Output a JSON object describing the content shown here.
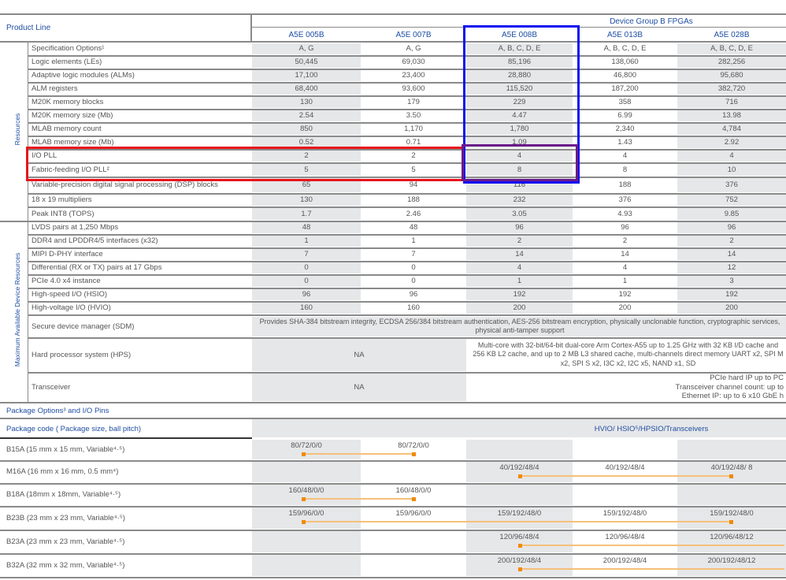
{
  "header": {
    "product_line": "Product Line",
    "group": "Device Group B FPGAs",
    "columns": [
      "A5E 005B",
      "A5E 007B",
      "A5E 008B",
      "A5E 013B",
      "A5E 028B"
    ]
  },
  "sections": {
    "resources": "Resources",
    "max_resources": "Maximum Available Device Resources"
  },
  "resources_rows": [
    {
      "label": "Specification Options¹",
      "values": [
        "A, G",
        "A, G",
        "A, B, C, D, E",
        "A, B, C, D, E",
        "A, B, C, D, E"
      ]
    },
    {
      "label": "Logic elements (LEs)",
      "values": [
        "50,445",
        "69,030",
        "85,196",
        "138,060",
        "282,256"
      ]
    },
    {
      "label": "Adaptive logic modules (ALMs)",
      "values": [
        "17,100",
        "23,400",
        "28,880",
        "46,800",
        "95,680"
      ]
    },
    {
      "label": "ALM registers",
      "values": [
        "68,400",
        "93,600",
        "115,520",
        "187,200",
        "382,720"
      ]
    },
    {
      "label": "M20K memory blocks",
      "values": [
        "130",
        "179",
        "229",
        "358",
        "716"
      ]
    },
    {
      "label": "M20K memory size (Mb)",
      "values": [
        "2.54",
        "3.50",
        "4.47",
        "6.99",
        "13.98"
      ]
    },
    {
      "label": "MLAB memory count",
      "values": [
        "850",
        "1,170",
        "1,780",
        "2,340",
        "4,784"
      ]
    },
    {
      "label": "MLAB memory size (Mb)",
      "values": [
        "0.52",
        "0.71",
        "1.09",
        "1.43",
        "2.92"
      ]
    },
    {
      "label": "I/O PLL",
      "values": [
        "2",
        "2",
        "4",
        "4",
        "4"
      ]
    },
    {
      "label": "Fabric-feeding I/O PLL²",
      "values": [
        "5",
        "5",
        "8",
        "8",
        "10"
      ]
    },
    {
      "label": "Variable-precision digital signal processing (DSP) blocks",
      "values": [
        "65",
        "94",
        "116",
        "188",
        "376"
      ]
    },
    {
      "label": "18 x 19 multipliers",
      "values": [
        "130",
        "188",
        "232",
        "376",
        "752"
      ]
    },
    {
      "label": "Peak INT8 (TOPS)",
      "values": [
        "1.7",
        "2.46",
        "3.05",
        "4.93",
        "9.85"
      ]
    }
  ],
  "device_rows": [
    {
      "label": "LVDS pairs at 1,250 Mbps",
      "values": [
        "48",
        "48",
        "96",
        "96",
        "96"
      ]
    },
    {
      "label": "DDR4 and LPDDR4/5 interfaces (x32)",
      "values": [
        "1",
        "1",
        "2",
        "2",
        "2"
      ]
    },
    {
      "label": "MIPI D-PHY interface",
      "values": [
        "7",
        "7",
        "14",
        "14",
        "14"
      ]
    },
    {
      "label": "Differential (RX or TX) pairs at 17 Gbps",
      "values": [
        "0",
        "0",
        "4",
        "4",
        "12"
      ]
    },
    {
      "label": "PCIe 4.0 x4 instance",
      "values": [
        "0",
        "0",
        "1",
        "1",
        "3"
      ]
    },
    {
      "label": "High-speed I/O (HSIO)",
      "values": [
        "96",
        "96",
        "192",
        "192",
        "192"
      ]
    },
    {
      "label": "High-voltage I/O (HVIO)",
      "values": [
        "160",
        "160",
        "200",
        "200",
        "200"
      ]
    }
  ],
  "sdm": {
    "label": "Secure device manager (SDM)",
    "text": "Provides SHA-384 bitstream integrity, ECDSA 256/384 bitstream authentication, AES-256 bitstream encryption, physically unclonable function, cryptographic services, physical anti-tamper support"
  },
  "hps": {
    "label": "Hard processor system (HPS)",
    "na": "NA",
    "text": "Multi-core with 32-bit/64-bit dual-core Arm Cortex-A55 up to 1.25 GHz with 32 KB I/D cache and 256 KB L2 cache, and up to 2 MB L3 shared cache, multi-channels direct memory UART x2, SPI M x2, SPI S x2, I3C x2, I2C x5, NAND x1, SD"
  },
  "transceiver": {
    "label": "Transceiver",
    "na": "NA",
    "lines": [
      "PCIe hard IP up to PC",
      "Transceiver channel count: up to",
      "Ethernet IP: up to 6 x10 GbE h"
    ]
  },
  "package": {
    "title": "Package Options³ and I/O Pins",
    "code_header": "Package code ( Package size, ball pitch)",
    "io_header": "HVIO/ HSIO⁵/HPSIO/Transceivers",
    "rows": [
      {
        "label": "B15A (15 mm x 15 mm, Variable⁴·⁵)",
        "values": [
          "80/72/0/0",
          "80/72/0/0",
          "",
          "",
          ""
        ],
        "span": [
          0,
          1
        ]
      },
      {
        "label": "M16A (16 mm x 16 mm, 0.5 mm⁴)",
        "values": [
          "",
          "",
          "40/192/48/4",
          "40/192/48/4",
          "40/192/48/ 8"
        ],
        "span": [
          2,
          4
        ]
      },
      {
        "label": "B18A (18mm x 18mm, Variable⁴·⁵)",
        "values": [
          "160/48/0/0",
          "160/48/0/0",
          "",
          "",
          ""
        ],
        "span": [
          0,
          1
        ]
      },
      {
        "label": "B23B (23 mm x 23 mm, Variable⁴·⁵)",
        "values": [
          "159/96/0/0",
          "159/96/0/0",
          "159/192/48/0",
          "159/192/48/0",
          "159/192/48/0"
        ],
        "span": [
          0,
          4
        ]
      },
      {
        "label": "B23A (23 mm x 23 mm, Variable⁴·⁵)",
        "values": [
          "",
          "",
          "120/96/48/4",
          "120/96/48/4",
          "120/96/48/12"
        ],
        "span": [
          2,
          5
        ]
      },
      {
        "label": "B32A (32 mm x 32 mm, Variable⁴·⁵)",
        "values": [
          "",
          "",
          "200/192/48/4",
          "200/192/48/4",
          "200/192/48/12"
        ],
        "span": [
          2,
          5
        ]
      }
    ]
  },
  "colors": {
    "blue_text": "#1f4ea3",
    "highlight_red": "#e8141c",
    "highlight_blue": "#1010f0",
    "highlight_purple": "#6a1a8a",
    "range_line": "#f08a00"
  }
}
